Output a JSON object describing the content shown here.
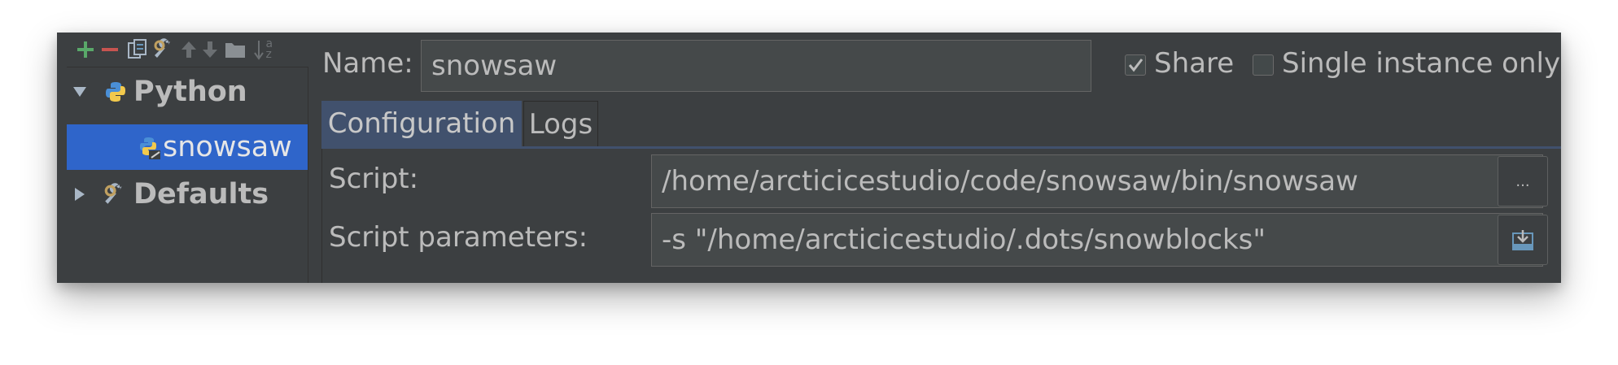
{
  "toolbar": {
    "icons": [
      "add-icon",
      "remove-icon",
      "copy-icon",
      "wrench-icon",
      "move-up-icon",
      "move-down-icon",
      "folder-icon",
      "sort-icon"
    ],
    "sort_letters": "az"
  },
  "tree": {
    "items": [
      {
        "label": "Python",
        "expanded": true,
        "icon": "python-icon"
      },
      {
        "label": "snowsaw",
        "selected": true,
        "icon": "python-script-icon"
      },
      {
        "label": "Defaults",
        "expanded": false,
        "icon": "wrench-icon"
      }
    ]
  },
  "name_row": {
    "label": "Name:",
    "value": "snowsaw",
    "share_label": "Share",
    "share_checked": true,
    "single_instance_label": "Single instance only",
    "single_instance_checked": false
  },
  "tabs": [
    {
      "label": "Configuration",
      "active": true
    },
    {
      "label": "Logs",
      "active": false
    }
  ],
  "config": {
    "script_label": "Script:",
    "script_value": "/home/arcticicestudio/code/snowsaw/bin/snowsaw",
    "browse_label": "...",
    "params_label": "Script parameters:",
    "params_value": "-s \"/home/arcticicestudio/.dots/snowblocks\""
  },
  "colors": {
    "panel": "#3c3f41",
    "selection": "#2f65ca",
    "active_tab": "#41516d",
    "field_bg": "#45494a",
    "text": "#bbbbbb",
    "add_green": "#59a869",
    "remove_red": "#c75450"
  }
}
